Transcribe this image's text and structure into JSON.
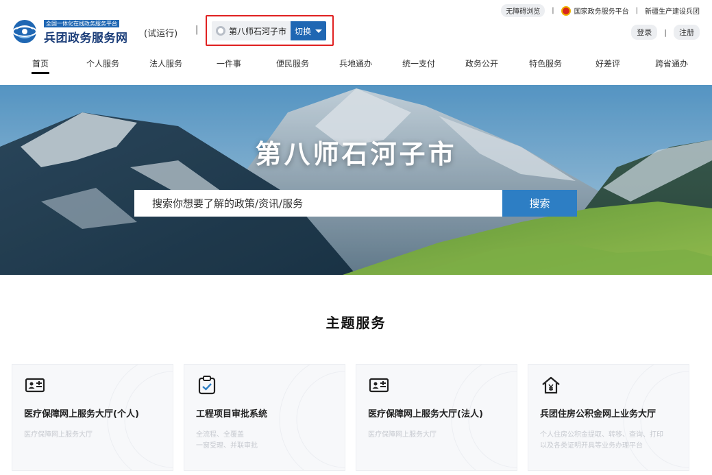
{
  "header": {
    "logo_tagline": "全国一体化在线政务服务平台",
    "logo_name": "兵团政务服务网",
    "trial_label": "(试运行)",
    "pipe": "|",
    "city_name": "第八师石河子市",
    "switch_label": "切换"
  },
  "top_links": {
    "accessibility": "无障碍浏览",
    "national_platform": "国家政务服务平台",
    "xpcc": "新疆生产建设兵团",
    "separator": "|"
  },
  "auth": {
    "login": "登录",
    "register": "注册",
    "separator": "|"
  },
  "nav": {
    "items": [
      "首页",
      "个人服务",
      "法人服务",
      "一件事",
      "便民服务",
      "兵地通办",
      "统一支付",
      "政务公开",
      "特色服务",
      "好差评",
      "跨省通办"
    ],
    "active_index": 0
  },
  "hero": {
    "title": "第八师石河子市",
    "search_placeholder": "搜索你想要了解的政策/资讯/服务",
    "search_button": "搜索"
  },
  "theme_section": {
    "title": "主题服务",
    "cards": [
      {
        "icon": "id-card-icon",
        "title": "医疗保障网上服务大厅(个人)",
        "desc_line1": "医疗保障网上服务大厅",
        "desc_line2": ""
      },
      {
        "icon": "clipboard-check-icon",
        "title": "工程项目审批系统",
        "desc_line1": "全流程、全覆盖",
        "desc_line2": "一窗受理、并联审批"
      },
      {
        "icon": "id-card-icon",
        "title": "医疗保障网上服务大厅(法人)",
        "desc_line1": "医疗保障网上服务大厅",
        "desc_line2": ""
      },
      {
        "icon": "house-yuan-icon",
        "title": "兵团住房公积金网上业务大厅",
        "desc_line1": "个人住房公积金提取、转移、查询、打印",
        "desc_line2": "以及各类证明开具等业务办理平台"
      }
    ]
  },
  "colors": {
    "brand_blue": "#1f67b3",
    "search_blue": "#2d7ec4",
    "highlight_red": "#e02020"
  }
}
